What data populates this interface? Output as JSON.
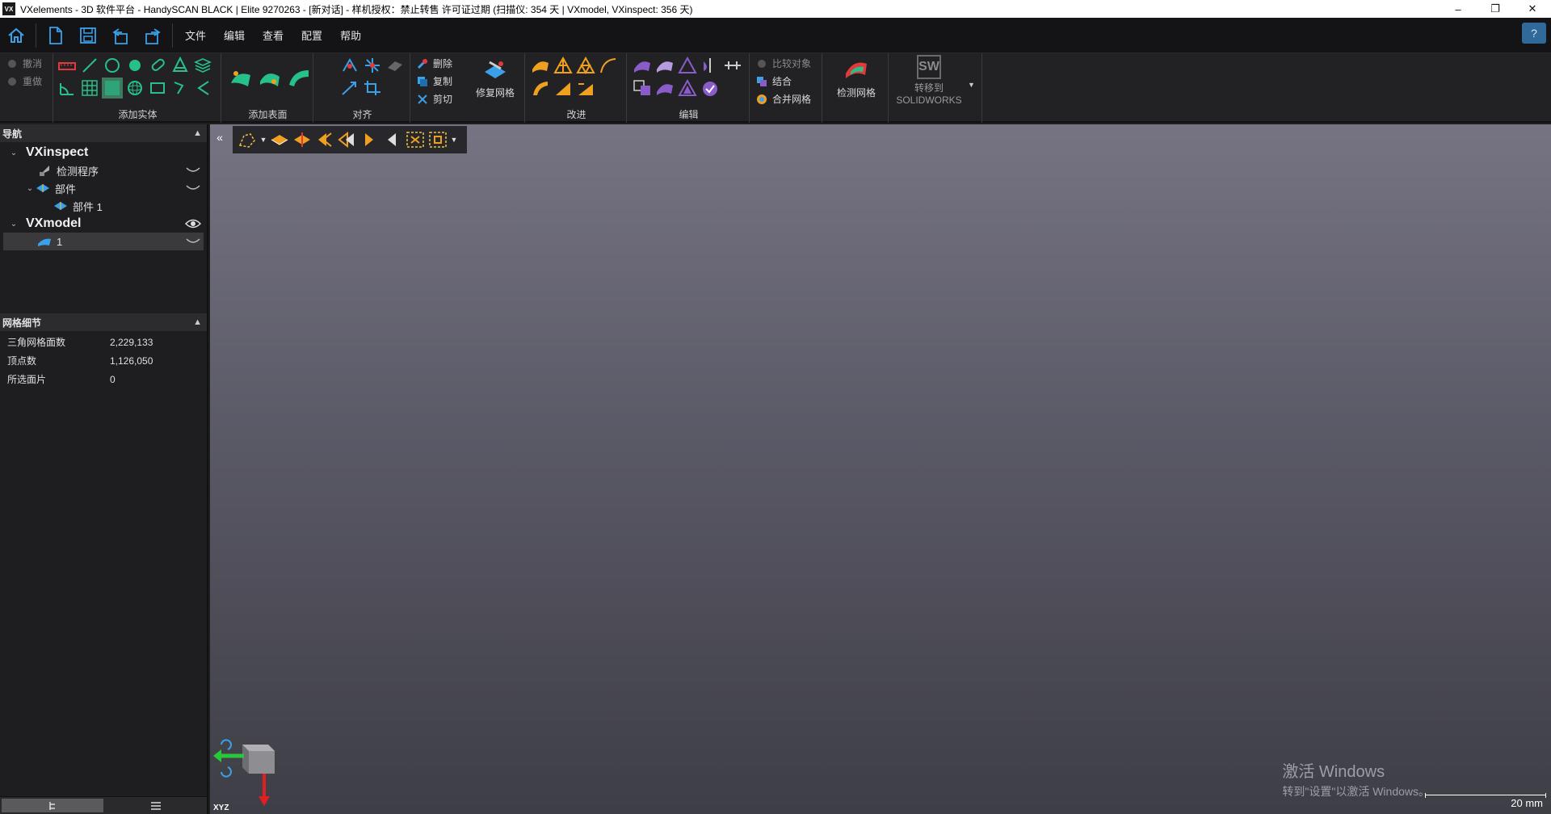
{
  "window": {
    "app_icon": "VX",
    "title": "VXelements - 3D 软件平台 - HandySCAN BLACK | Elite 9270263 - [新对话] - 样机授权：禁止转售 许可证过期 (扫描仪: 354 天 | VXmodel, VXinspect: 356 天)",
    "minimize": "–",
    "restore": "❐",
    "close": "✕"
  },
  "menubar": {
    "items": [
      "文件",
      "编辑",
      "查看",
      "配置",
      "帮助"
    ],
    "help_bubble": "?"
  },
  "ribbon": {
    "undo": "撤消",
    "redo": "重做",
    "groups": {
      "add_entity": "添加实体",
      "add_surface": "添加表面",
      "align": "对齐",
      "improve": "改进",
      "edit": "编辑"
    },
    "clipboard": {
      "delete": "删除",
      "copy": "复制",
      "cut": "剪切"
    },
    "repair_mesh": "修复网格",
    "compare": {
      "compare_object": "比较对象",
      "combine": "结合",
      "merge_mesh": "合并网格"
    },
    "inspect_mesh": "检测网格",
    "solidworks": {
      "line1": "转移到",
      "line2": "SOLIDWORKS",
      "logo": "SW"
    },
    "accent_green": "#27c08a",
    "accent_orange": "#f0a020",
    "accent_purple": "#8a5cc9"
  },
  "navigation": {
    "header": "导航",
    "tree": {
      "vxinspect": "VXinspect",
      "inspect_program": "检测程序",
      "parts": "部件",
      "part1": "部件 1",
      "vxmodel": "VXmodel",
      "item1": "1"
    }
  },
  "mesh_details": {
    "header": "网格细节",
    "rows": [
      {
        "key": "三角网格面数",
        "value": "2,229,133"
      },
      {
        "key": "顶点数",
        "value": "1,126,050"
      },
      {
        "key": "所选面片",
        "value": "0"
      }
    ]
  },
  "viewport": {
    "triad_label": "XYZ",
    "scale_label": "20 mm",
    "watermark_line1": "激活 Windows",
    "watermark_line2": "转到\"设置\"以激活 Windows。"
  }
}
